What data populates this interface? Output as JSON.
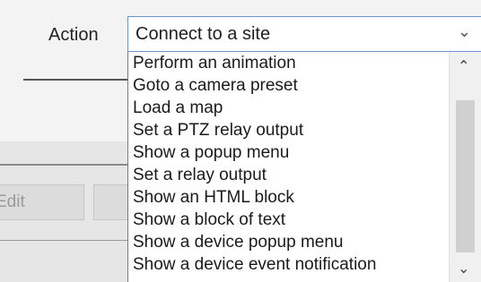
{
  "form": {
    "action_label": "Action",
    "edit_button_label": "Edit"
  },
  "action_select": {
    "selected_value": "Connect to a site",
    "options": [
      "Perform an animation",
      "Goto a camera preset",
      "Load a map",
      "Set a PTZ relay output",
      "Show a popup menu",
      "Set a relay output",
      "Show an HTML block",
      "Show a block of text",
      "Show a device popup menu",
      "Show a device event notification"
    ]
  },
  "icons": {
    "dropdown": "chevron-down-icon",
    "scroll_up": "chevron-up-icon",
    "scroll_down": "chevron-down-icon"
  },
  "colors": {
    "focus_border": "#6d95c9"
  }
}
